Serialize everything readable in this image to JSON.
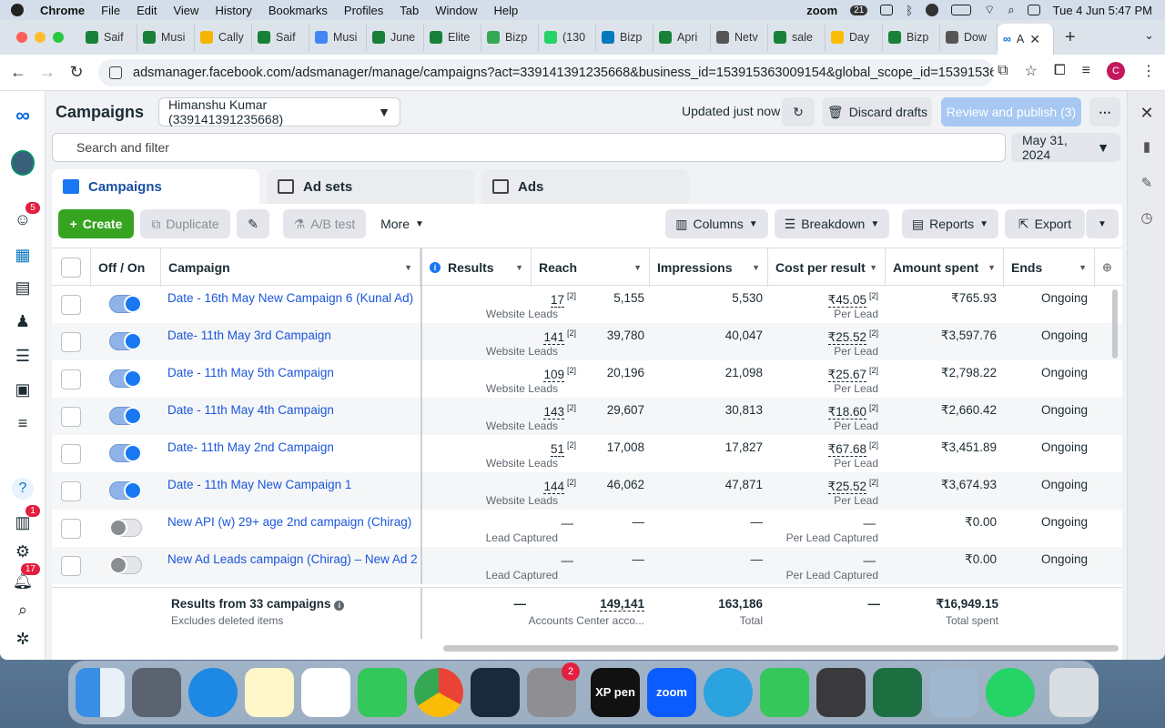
{
  "menubar": {
    "app": "Chrome",
    "menus": [
      "File",
      "Edit",
      "View",
      "History",
      "Bookmarks",
      "Profiles",
      "Tab",
      "Window",
      "Help"
    ],
    "zoom": "zoom",
    "notif_count": "21",
    "datetime": "Tue 4 Jun  5:47 PM"
  },
  "browser": {
    "tabs": [
      {
        "label": "Saif",
        "color": "#188038"
      },
      {
        "label": "Musi",
        "color": "#188038"
      },
      {
        "label": "Cally",
        "color": "#f4b400"
      },
      {
        "label": "Saif",
        "color": "#188038"
      },
      {
        "label": "Musi",
        "color": "#4285f4"
      },
      {
        "label": "June",
        "color": "#188038"
      },
      {
        "label": "Elite",
        "color": "#188038"
      },
      {
        "label": "Bizp",
        "color": "#34a853"
      },
      {
        "label": "(130",
        "color": "#25d366"
      },
      {
        "label": "Bizp",
        "color": "#0079bf"
      },
      {
        "label": "Apri",
        "color": "#188038"
      },
      {
        "label": "Netv",
        "color": "#555555"
      },
      {
        "label": "sale",
        "color": "#188038"
      },
      {
        "label": "Day",
        "color": "#fbbc04"
      },
      {
        "label": "Bizp",
        "color": "#188038"
      },
      {
        "label": "Dow",
        "color": "#555555"
      }
    ],
    "active_tab": "A",
    "url": "adsmanager.facebook.com/adsmanager/manage/campaigns?act=339141391235668&business_id=153915363009154&global_scope_id=15391536300915...",
    "profile_initial": "C"
  },
  "leftnav": {
    "badges": {
      "notifications": "5",
      "inbox": "1",
      "alerts": "17"
    }
  },
  "header": {
    "title": "Campaigns",
    "account": "Himanshu Kumar (339141391235668)",
    "updated": "Updated just now",
    "discard": "Discard drafts",
    "review": "Review and publish (3)",
    "search_placeholder": "Search and filter",
    "date": "May 31, 2024"
  },
  "tabs": {
    "campaigns": "Campaigns",
    "adsets": "Ad sets",
    "ads": "Ads"
  },
  "actions": {
    "create": "Create",
    "duplicate": "Duplicate",
    "abtest": "A/B test",
    "more": "More",
    "columns": "Columns",
    "breakdown": "Breakdown",
    "reports": "Reports",
    "export": "Export"
  },
  "table": {
    "headers": {
      "offon": "Off / On",
      "campaign": "Campaign",
      "results": "Results",
      "reach": "Reach",
      "impressions": "Impressions",
      "cpr": "Cost per result",
      "amount": "Amount spent",
      "ends": "Ends"
    },
    "rows": [
      {
        "name": "Date - 16th May New Campaign 6 (Kunal Ad)",
        "on": true,
        "results": "17",
        "results_ref": "[2]",
        "results_type": "Website Leads",
        "reach": "5,155",
        "impressions": "5,530",
        "cpr": "₹45.05",
        "cpr_ref": "[2]",
        "cpr_type": "Per Lead",
        "amount": "₹765.93",
        "ends": "Ongoing"
      },
      {
        "name": "Date- 11th May 3rd Campaign",
        "on": true,
        "results": "141",
        "results_ref": "[2]",
        "results_type": "Website Leads",
        "reach": "39,780",
        "impressions": "40,047",
        "cpr": "₹25.52",
        "cpr_ref": "[2]",
        "cpr_type": "Per Lead",
        "amount": "₹3,597.76",
        "ends": "Ongoing"
      },
      {
        "name": "Date - 11th May 5th Campaign",
        "on": true,
        "results": "109",
        "results_ref": "[2]",
        "results_type": "Website Leads",
        "reach": "20,196",
        "impressions": "21,098",
        "cpr": "₹25.67",
        "cpr_ref": "[2]",
        "cpr_type": "Per Lead",
        "amount": "₹2,798.22",
        "ends": "Ongoing"
      },
      {
        "name": "Date - 11th May 4th Campaign",
        "on": true,
        "results": "143",
        "results_ref": "[2]",
        "results_type": "Website Leads",
        "reach": "29,607",
        "impressions": "30,813",
        "cpr": "₹18.60",
        "cpr_ref": "[2]",
        "cpr_type": "Per Lead",
        "amount": "₹2,660.42",
        "ends": "Ongoing"
      },
      {
        "name": "Date- 11th May 2nd Campaign",
        "on": true,
        "results": "51",
        "results_ref": "[2]",
        "results_type": "Website Leads",
        "reach": "17,008",
        "impressions": "17,827",
        "cpr": "₹67.68",
        "cpr_ref": "[2]",
        "cpr_type": "Per Lead",
        "amount": "₹3,451.89",
        "ends": "Ongoing"
      },
      {
        "name": "Date - 11th May New Campaign 1",
        "on": true,
        "results": "144",
        "results_ref": "[2]",
        "results_type": "Website Leads",
        "reach": "46,062",
        "impressions": "47,871",
        "cpr": "₹25.52",
        "cpr_ref": "[2]",
        "cpr_type": "Per Lead",
        "amount": "₹3,674.93",
        "ends": "Ongoing"
      },
      {
        "name": "New API (w) 29+ age 2nd campaign (Chirag)",
        "on": false,
        "results": "—",
        "results_ref": "",
        "results_type": "Lead Captured",
        "reach": "—",
        "impressions": "—",
        "cpr": "—",
        "cpr_ref": "",
        "cpr_type": "Per Lead Captured",
        "amount": "₹0.00",
        "ends": "Ongoing"
      },
      {
        "name": "New Ad Leads campaign (Chirag) – New Ad 2",
        "on": false,
        "results": "—",
        "results_ref": "",
        "results_type": "Lead Captured",
        "reach": "—",
        "impressions": "—",
        "cpr": "—",
        "cpr_ref": "",
        "cpr_type": "Per Lead Captured",
        "amount": "₹0.00",
        "ends": "Ongoing"
      }
    ],
    "footer": {
      "title": "Results from 33 campaigns",
      "sub": "Excludes deleted items",
      "results": "—",
      "reach": "149,141",
      "reach_sub": "Accounts Center acco...",
      "impressions": "163,186",
      "impressions_sub": "Total",
      "cpr": "—",
      "amount": "₹16,949.15",
      "amount_sub": "Total spent"
    }
  },
  "dock": {
    "settings_badge": "2",
    "xppen": "XP pen",
    "zoom": "zoom"
  }
}
